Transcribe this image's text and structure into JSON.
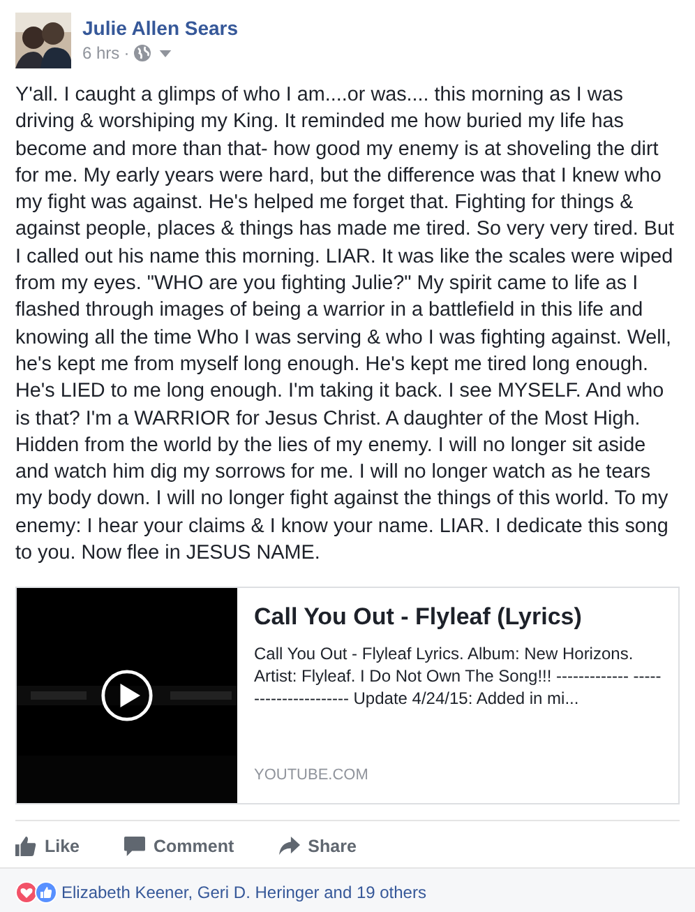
{
  "post": {
    "author": "Julie Allen Sears",
    "time": "6 hrs",
    "separator": "·",
    "public": true,
    "text": "Y'all. I caught a glimps of who I am....or was.... this morning as I was driving & worshiping my King. It reminded me how buried my life has become and more than that- how good my enemy is at shoveling the dirt for me. My early years were hard, but the difference was that I knew who my fight was against. He's helped me forget that. Fighting for things & against people, places & things has made me tired. So very very tired. But I called out his name this morning. LIAR. It was like the scales were wiped from my eyes. \"WHO are you fighting Julie?\" My spirit came to life as I flashed through images of being a warrior in a battlefield in this life and knowing all the time Who I was serving & who I was fighting against. Well, he's kept me from myself long enough. He's kept me tired long enough. He's LIED to me long enough. I'm taking it back. I see MYSELF. And who is that? I'm a WARRIOR for Jesus Christ. A daughter of the Most High. Hidden from the world by the lies of my enemy. I will no longer sit aside and watch him dig my sorrows for me. I will no longer watch as he tears my body down. I will no longer fight against the things of this world. To my enemy: I hear your claims & I know your name. LIAR. I dedicate this song to you. Now flee in JESUS NAME."
  },
  "link": {
    "title": "Call You Out - Flyleaf (Lyrics)",
    "description": "Call You Out - Flyleaf Lyrics. Album: New Horizons. Artist: Flyleaf. I Do Not Own The Song!!! ------------- ---------------------- Update 4/24/15: Added in mi...",
    "domain": "YOUTUBE.COM"
  },
  "actions": [
    {
      "kind": "like",
      "label": "Like"
    },
    {
      "kind": "comment",
      "label": "Comment"
    },
    {
      "kind": "share",
      "label": "Share"
    }
  ],
  "reactions": {
    "icons": [
      {
        "kind": "love"
      },
      {
        "kind": "like"
      }
    ],
    "summary": "Elizabeth Keener, Geri D. Heringer and 19 others"
  }
}
